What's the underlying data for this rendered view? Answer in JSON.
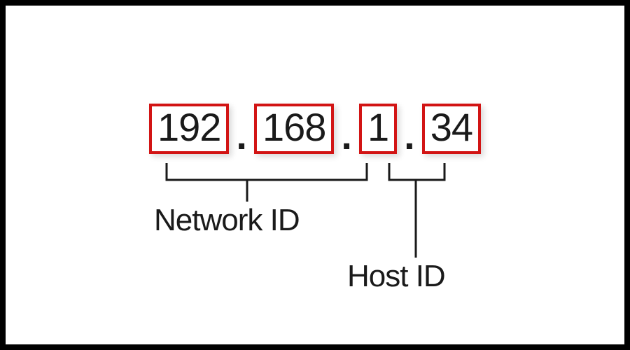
{
  "ip": {
    "octets": [
      "192",
      "168",
      "1",
      "34"
    ],
    "dot": "."
  },
  "labels": {
    "network": "Network ID",
    "host": "Host ID"
  },
  "colors": {
    "border": "#000000",
    "box": "#d21414",
    "text": "#1a1a1a"
  }
}
